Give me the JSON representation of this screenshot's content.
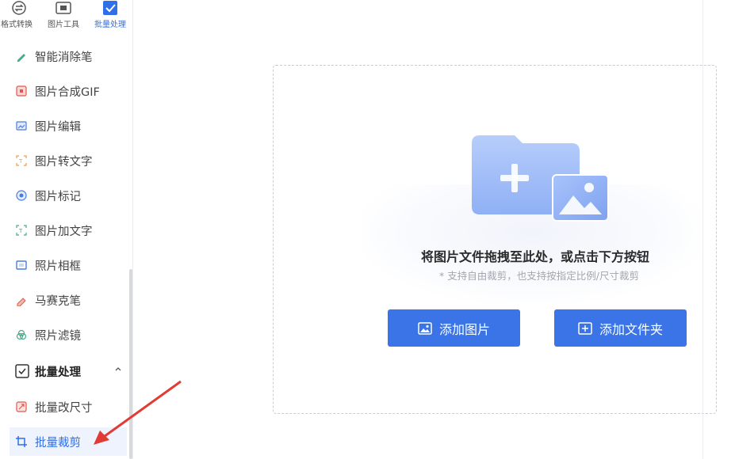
{
  "top_tabs": [
    {
      "label": "格式转换"
    },
    {
      "label": "图片工具"
    },
    {
      "label": "批量处理"
    }
  ],
  "menu": {
    "items": [
      {
        "label": "智能消除笔",
        "icon": "eraser-pen-icon"
      },
      {
        "label": "图片合成GIF",
        "icon": "gif-icon"
      },
      {
        "label": "图片编辑",
        "icon": "image-edit-icon"
      },
      {
        "label": "图片转文字",
        "icon": "image-to-text-icon"
      },
      {
        "label": "图片标记",
        "icon": "mark-icon"
      },
      {
        "label": "图片加文字",
        "icon": "add-text-icon"
      },
      {
        "label": "照片相框",
        "icon": "frame-icon"
      },
      {
        "label": "马赛克笔",
        "icon": "mosaic-pen-icon"
      },
      {
        "label": "照片滤镜",
        "icon": "filter-icon"
      }
    ],
    "group": {
      "label": "批量处理",
      "icon": "batch-icon"
    },
    "sub_items": [
      {
        "label": "批量改尺寸",
        "icon": "resize-icon"
      },
      {
        "label": "批量裁剪",
        "icon": "crop-icon"
      }
    ]
  },
  "dropzone": {
    "title": "将图片文件拖拽至此处，或点击下方按钮",
    "hint": "* 支持自由裁剪，也支持按指定比例/尺寸裁剪",
    "add_image_label": "添加图片",
    "add_folder_label": "添加文件夹"
  },
  "colors": {
    "accent": "#3a74e6",
    "annotation_arrow": "#e23b36"
  }
}
